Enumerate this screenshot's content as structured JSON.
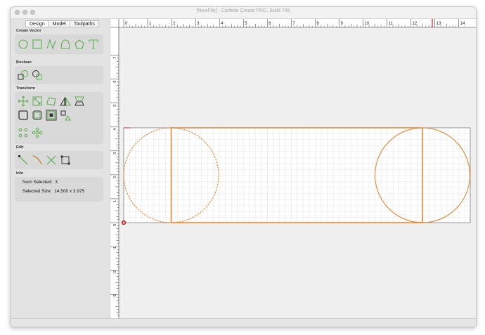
{
  "window": {
    "title": "[NewFile] - Carbide Create PRO, Build 749"
  },
  "tabs": [
    {
      "label": "Design",
      "active": true
    },
    {
      "label": "Model",
      "active": false
    },
    {
      "label": "Toolpaths",
      "active": false
    }
  ],
  "sections": {
    "create_vector": "Create Vector",
    "boolean": "Boolean",
    "transform": "Transform",
    "edit": "Edit",
    "info": "Info"
  },
  "info": {
    "num_selected_label": "Num Selected:",
    "num_selected_value": "3",
    "selected_size_label": "Selected Size:",
    "selected_size_value": "14.500 x 3.975"
  },
  "ruler": {
    "x_labels": [
      "0",
      "1",
      "2",
      "3",
      "4",
      "5",
      "6",
      "7",
      "8",
      "9",
      "10",
      "11",
      "12",
      "13",
      "14"
    ],
    "y_labels": [
      "7",
      "6",
      "5",
      "4",
      "3",
      "2",
      "1",
      "0",
      "-1",
      "-2",
      "-3",
      "-4"
    ],
    "marker_value": "13"
  },
  "colors": {
    "accent_green": "#5aae4a",
    "vector_orange": "#e87a1e",
    "origin_red": "#d42020"
  },
  "icons": {
    "create_vector": [
      "circle-icon",
      "rectangle-icon",
      "polyline-icon",
      "curve-icon",
      "polygon-icon",
      "text-icon"
    ],
    "boolean": [
      "weld-icon",
      "union-icon"
    ],
    "transform": [
      "move-icon",
      "scale-icon",
      "rotate-icon",
      "mirror-icon",
      "skew-icon",
      "fillet-icon",
      "offset-icon",
      "inside-outside-icon",
      "align-icon",
      "grid-array-icon",
      "circular-array-icon"
    ],
    "edit": [
      "edit-nodes-icon",
      "trim-icon",
      "cut-icon",
      "join-icon"
    ]
  }
}
